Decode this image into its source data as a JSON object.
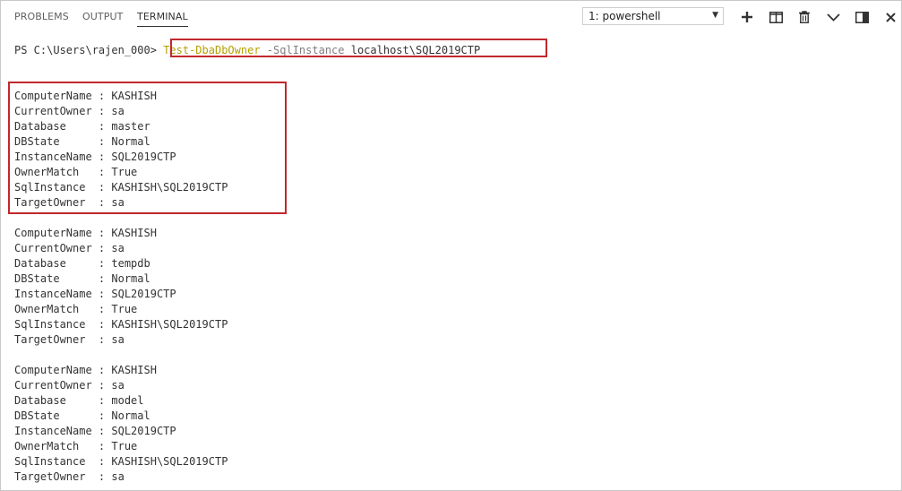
{
  "tabs": [
    {
      "label": "PROBLEMS"
    },
    {
      "label": "OUTPUT"
    },
    {
      "label": "TERMINAL"
    }
  ],
  "terminal_select": {
    "value": "1: powershell"
  },
  "toolbar_icons": [
    "plus-icon",
    "split-terminal-icon",
    "trash-icon",
    "chevron-down-icon",
    "maximize-panel-icon",
    "close-icon"
  ],
  "command": {
    "prompt": "PS C:\\Users\\rajen_000>",
    "cmdlet": "Test-DbaDbOwner",
    "param": "-SqlInstance",
    "arg": "localhost\\SQL2019CTP"
  },
  "results": [
    [
      "ComputerName : KASHISH",
      "CurrentOwner : sa",
      "Database     : master",
      "DBState      : Normal",
      "InstanceName : SQL2019CTP",
      "OwnerMatch   : True",
      "SqlInstance  : KASHISH\\SQL2019CTP",
      "TargetOwner  : sa"
    ],
    [
      "ComputerName : KASHISH",
      "CurrentOwner : sa",
      "Database     : tempdb",
      "DBState      : Normal",
      "InstanceName : SQL2019CTP",
      "OwnerMatch   : True",
      "SqlInstance  : KASHISH\\SQL2019CTP",
      "TargetOwner  : sa"
    ],
    [
      "ComputerName : KASHISH",
      "CurrentOwner : sa",
      "Database     : model",
      "DBState      : Normal",
      "InstanceName : SQL2019CTP",
      "OwnerMatch   : True",
      "SqlInstance  : KASHISH\\SQL2019CTP",
      "TargetOwner  : sa"
    ]
  ],
  "colors": {
    "highlight": "#c0282d",
    "cmdlet": "#b5a000",
    "param": "#808080"
  }
}
